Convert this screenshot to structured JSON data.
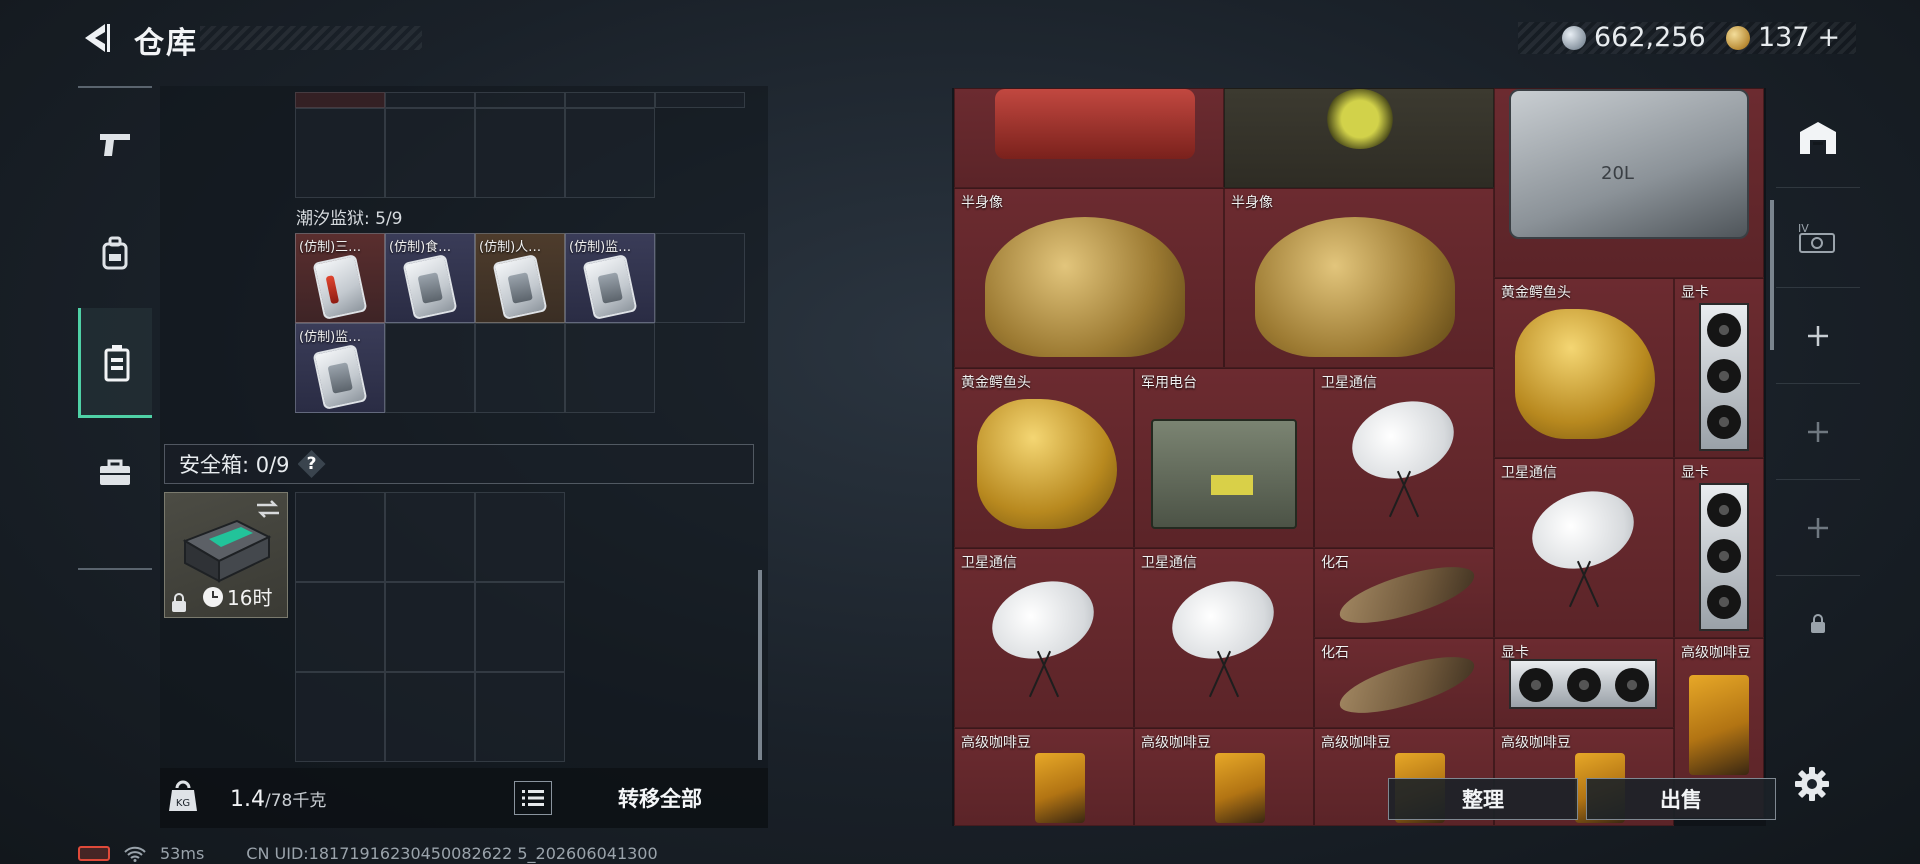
{
  "header": {
    "title": "仓库",
    "currency_primary": "662,256",
    "currency_secondary": "137",
    "currency_secondary_plus": "+"
  },
  "left_nav": {
    "items": [
      {
        "icon": "pistol-icon"
      },
      {
        "icon": "backpack-icon"
      },
      {
        "icon": "container-icon",
        "active": true
      },
      {
        "icon": "briefcase-icon"
      }
    ]
  },
  "inventory": {
    "prison_label": "潮汐监狱: 5/9",
    "prison_items": [
      "(仿制)三…",
      "(仿制)食…",
      "(仿制)人…",
      "(仿制)监…",
      "(仿制)监…"
    ],
    "safebox_label": "安全箱: 0/9",
    "help_label": "?",
    "safebox_timer": "16时",
    "weight_value": "1.4",
    "weight_unit": "/78千克",
    "transfer_all": "转移全部"
  },
  "stash": {
    "items": [
      {
        "name": "半身像"
      },
      {
        "name": "半身像"
      },
      {
        "name": "黄金鳄鱼头"
      },
      {
        "name": "显卡"
      },
      {
        "name": "黄金鳄鱼头"
      },
      {
        "name": "军用电台"
      },
      {
        "name": "卫星通信"
      },
      {
        "name": "卫星通信"
      },
      {
        "name": "显卡"
      },
      {
        "name": "卫星通信"
      },
      {
        "name": "卫星通信"
      },
      {
        "name": "化石"
      },
      {
        "name": "化石"
      },
      {
        "name": "显卡"
      },
      {
        "name": "高级咖啡豆"
      },
      {
        "name": "高级咖啡豆"
      },
      {
        "name": "高级咖啡豆"
      },
      {
        "name": "高级咖啡豆"
      },
      {
        "name": "高级咖啡豆"
      }
    ],
    "jerrycan_text": "20L"
  },
  "actions": {
    "sort": "整理",
    "sell": "出售"
  },
  "status": {
    "ping": "53ms",
    "uid": "CN UID:18171916230450082622 5_202606041300"
  },
  "colors": {
    "accent": "#4fd1a6",
    "stash_cell": "#6a2a2e"
  }
}
